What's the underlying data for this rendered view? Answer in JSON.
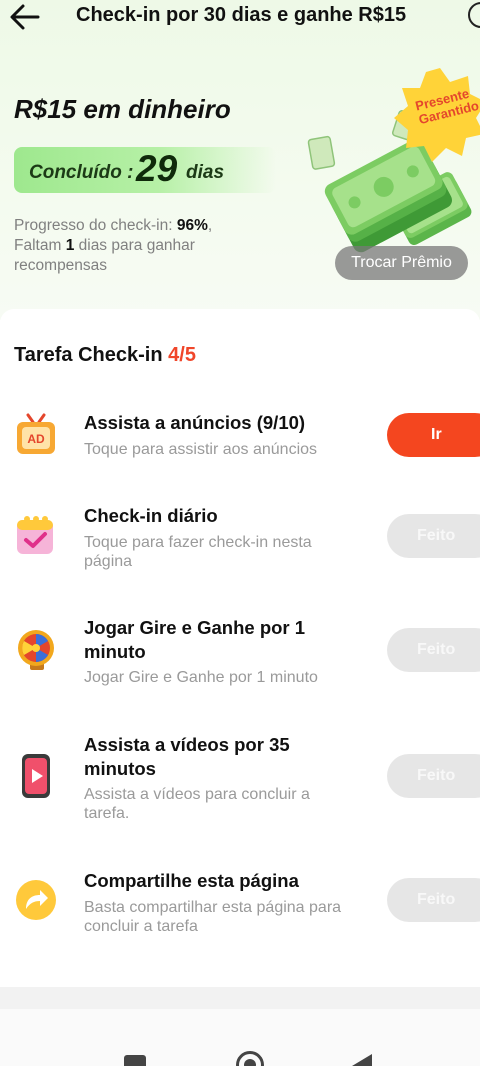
{
  "header": {
    "title": "Check-in por 30 dias e ganhe R$15"
  },
  "hero": {
    "reward_title": "R$15 em dinheiro",
    "completed_label": "Concluído :",
    "completed_days": "29",
    "completed_unit": "dias",
    "progress_prefix": "Progresso do check-in:",
    "progress_value": "96%",
    "progress_suffix": ",",
    "remaining_prefix": "Faltam",
    "remaining_value": "1",
    "remaining_suffix": "dias para ganhar recompensas",
    "badge_line1": "Presente",
    "badge_line2": "Garantido",
    "trade_button": "Trocar Prêmio"
  },
  "tasks_section": {
    "title": "Tarefa Check-in",
    "count": "4/5",
    "tasks": [
      {
        "title": "Assista a anúncios  (9/10)",
        "desc": "Toque para assistir aos anúncios",
        "button": "Ir",
        "icon": "ad-tv-icon",
        "state": "pending"
      },
      {
        "title": "Check-in diário",
        "desc": "Toque para fazer check-in nesta página",
        "button": "Feito",
        "icon": "calendar-check-icon",
        "state": "done"
      },
      {
        "title": "Jogar Gire e Ganhe por 1 minuto",
        "desc": "Jogar Gire e Ganhe por 1 minuto",
        "button": "Feito",
        "icon": "prize-wheel-icon",
        "state": "done"
      },
      {
        "title": "Assista a vídeos por 35 minutos",
        "desc": "Assista a vídeos para concluir a tarefa.",
        "button": "Feito",
        "icon": "video-phone-icon",
        "state": "done"
      },
      {
        "title": "Compartilhe esta página",
        "desc": "Basta compartilhar esta página para concluir a tarefa",
        "button": "Feito",
        "icon": "share-arrow-icon",
        "state": "done"
      }
    ]
  },
  "colors": {
    "accent": "#f4461f",
    "done_button": "#e6e6e6",
    "hero_bg": "#eef9e7",
    "completed_pill": "#9ee88e"
  }
}
